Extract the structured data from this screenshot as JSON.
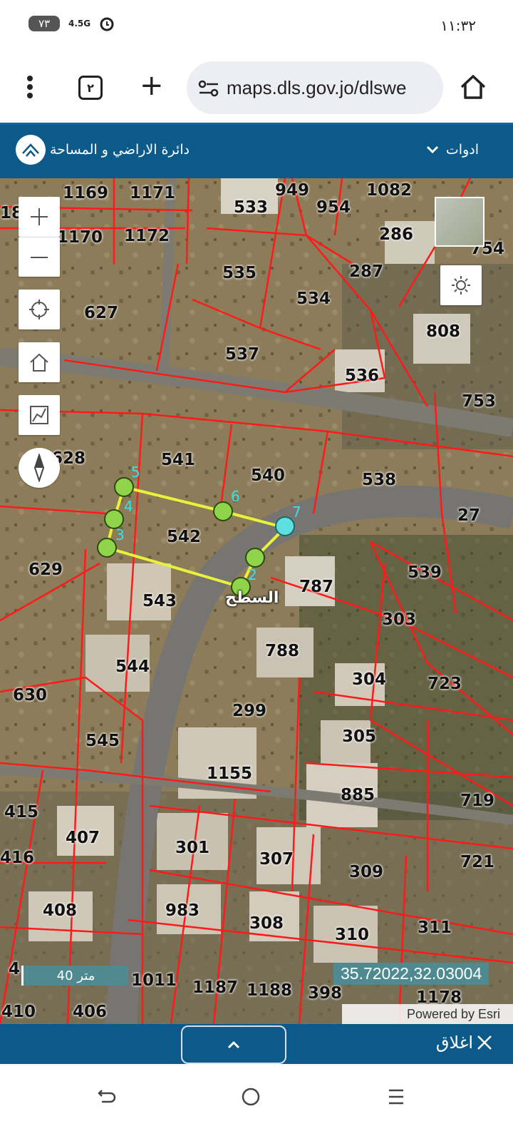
{
  "status_bar": {
    "battery": "٧٣",
    "network": "4.5G",
    "time": "١١:٣٢"
  },
  "browser": {
    "tab_count": "٢",
    "url": "maps.dls.gov.jo/dlswe"
  },
  "app": {
    "title": "دائرة الاراضي و المساحة",
    "tools_menu": "ادوات"
  },
  "map": {
    "parcel_labels": [
      {
        "text": "1169"
      },
      {
        "text": "1171"
      },
      {
        "text": "949"
      },
      {
        "text": "1082"
      },
      {
        "text": "533"
      },
      {
        "text": "954"
      },
      {
        "text": "1170"
      },
      {
        "text": "1172"
      },
      {
        "text": "286"
      },
      {
        "text": "754"
      },
      {
        "text": "535"
      },
      {
        "text": "287"
      },
      {
        "text": "534"
      },
      {
        "text": "627"
      },
      {
        "text": "808"
      },
      {
        "text": "537"
      },
      {
        "text": "536"
      },
      {
        "text": "753"
      },
      {
        "text": "628"
      },
      {
        "text": "541"
      },
      {
        "text": "540"
      },
      {
        "text": "538"
      },
      {
        "text": "27"
      },
      {
        "text": "542"
      },
      {
        "text": "629"
      },
      {
        "text": "539"
      },
      {
        "text": "787"
      },
      {
        "text": "543"
      },
      {
        "text": "303"
      },
      {
        "text": "788"
      },
      {
        "text": "544"
      },
      {
        "text": "304"
      },
      {
        "text": "723"
      },
      {
        "text": "630"
      },
      {
        "text": "299"
      },
      {
        "text": "305"
      },
      {
        "text": "545"
      },
      {
        "text": "1155"
      },
      {
        "text": "885"
      },
      {
        "text": "719"
      },
      {
        "text": "415"
      },
      {
        "text": "407"
      },
      {
        "text": "416"
      },
      {
        "text": "301"
      },
      {
        "text": "307"
      },
      {
        "text": "309"
      },
      {
        "text": "721"
      },
      {
        "text": "408"
      },
      {
        "text": "983"
      },
      {
        "text": "308"
      },
      {
        "text": "310"
      },
      {
        "text": "311"
      },
      {
        "text": "1011"
      },
      {
        "text": "1187"
      },
      {
        "text": "1188"
      },
      {
        "text": "398"
      },
      {
        "text": "1178"
      },
      {
        "text": "410"
      },
      {
        "text": "406"
      },
      {
        "text": "18"
      },
      {
        "text": "4"
      }
    ],
    "vertex_labels": [
      "5",
      "4",
      "3",
      "6",
      "2",
      "7"
    ],
    "measure_label": "السطح",
    "coordinates": "35.72022,32.03004",
    "scale": "40 متر",
    "attribution": "Powered by Esri"
  },
  "bottom": {
    "close_label": "اغلاق"
  },
  "colors": {
    "header": "#0c5a8a",
    "parcel_lines": "#ff1a1a",
    "measure_line": "#e8f23a",
    "vertex": "#8fd44a"
  }
}
